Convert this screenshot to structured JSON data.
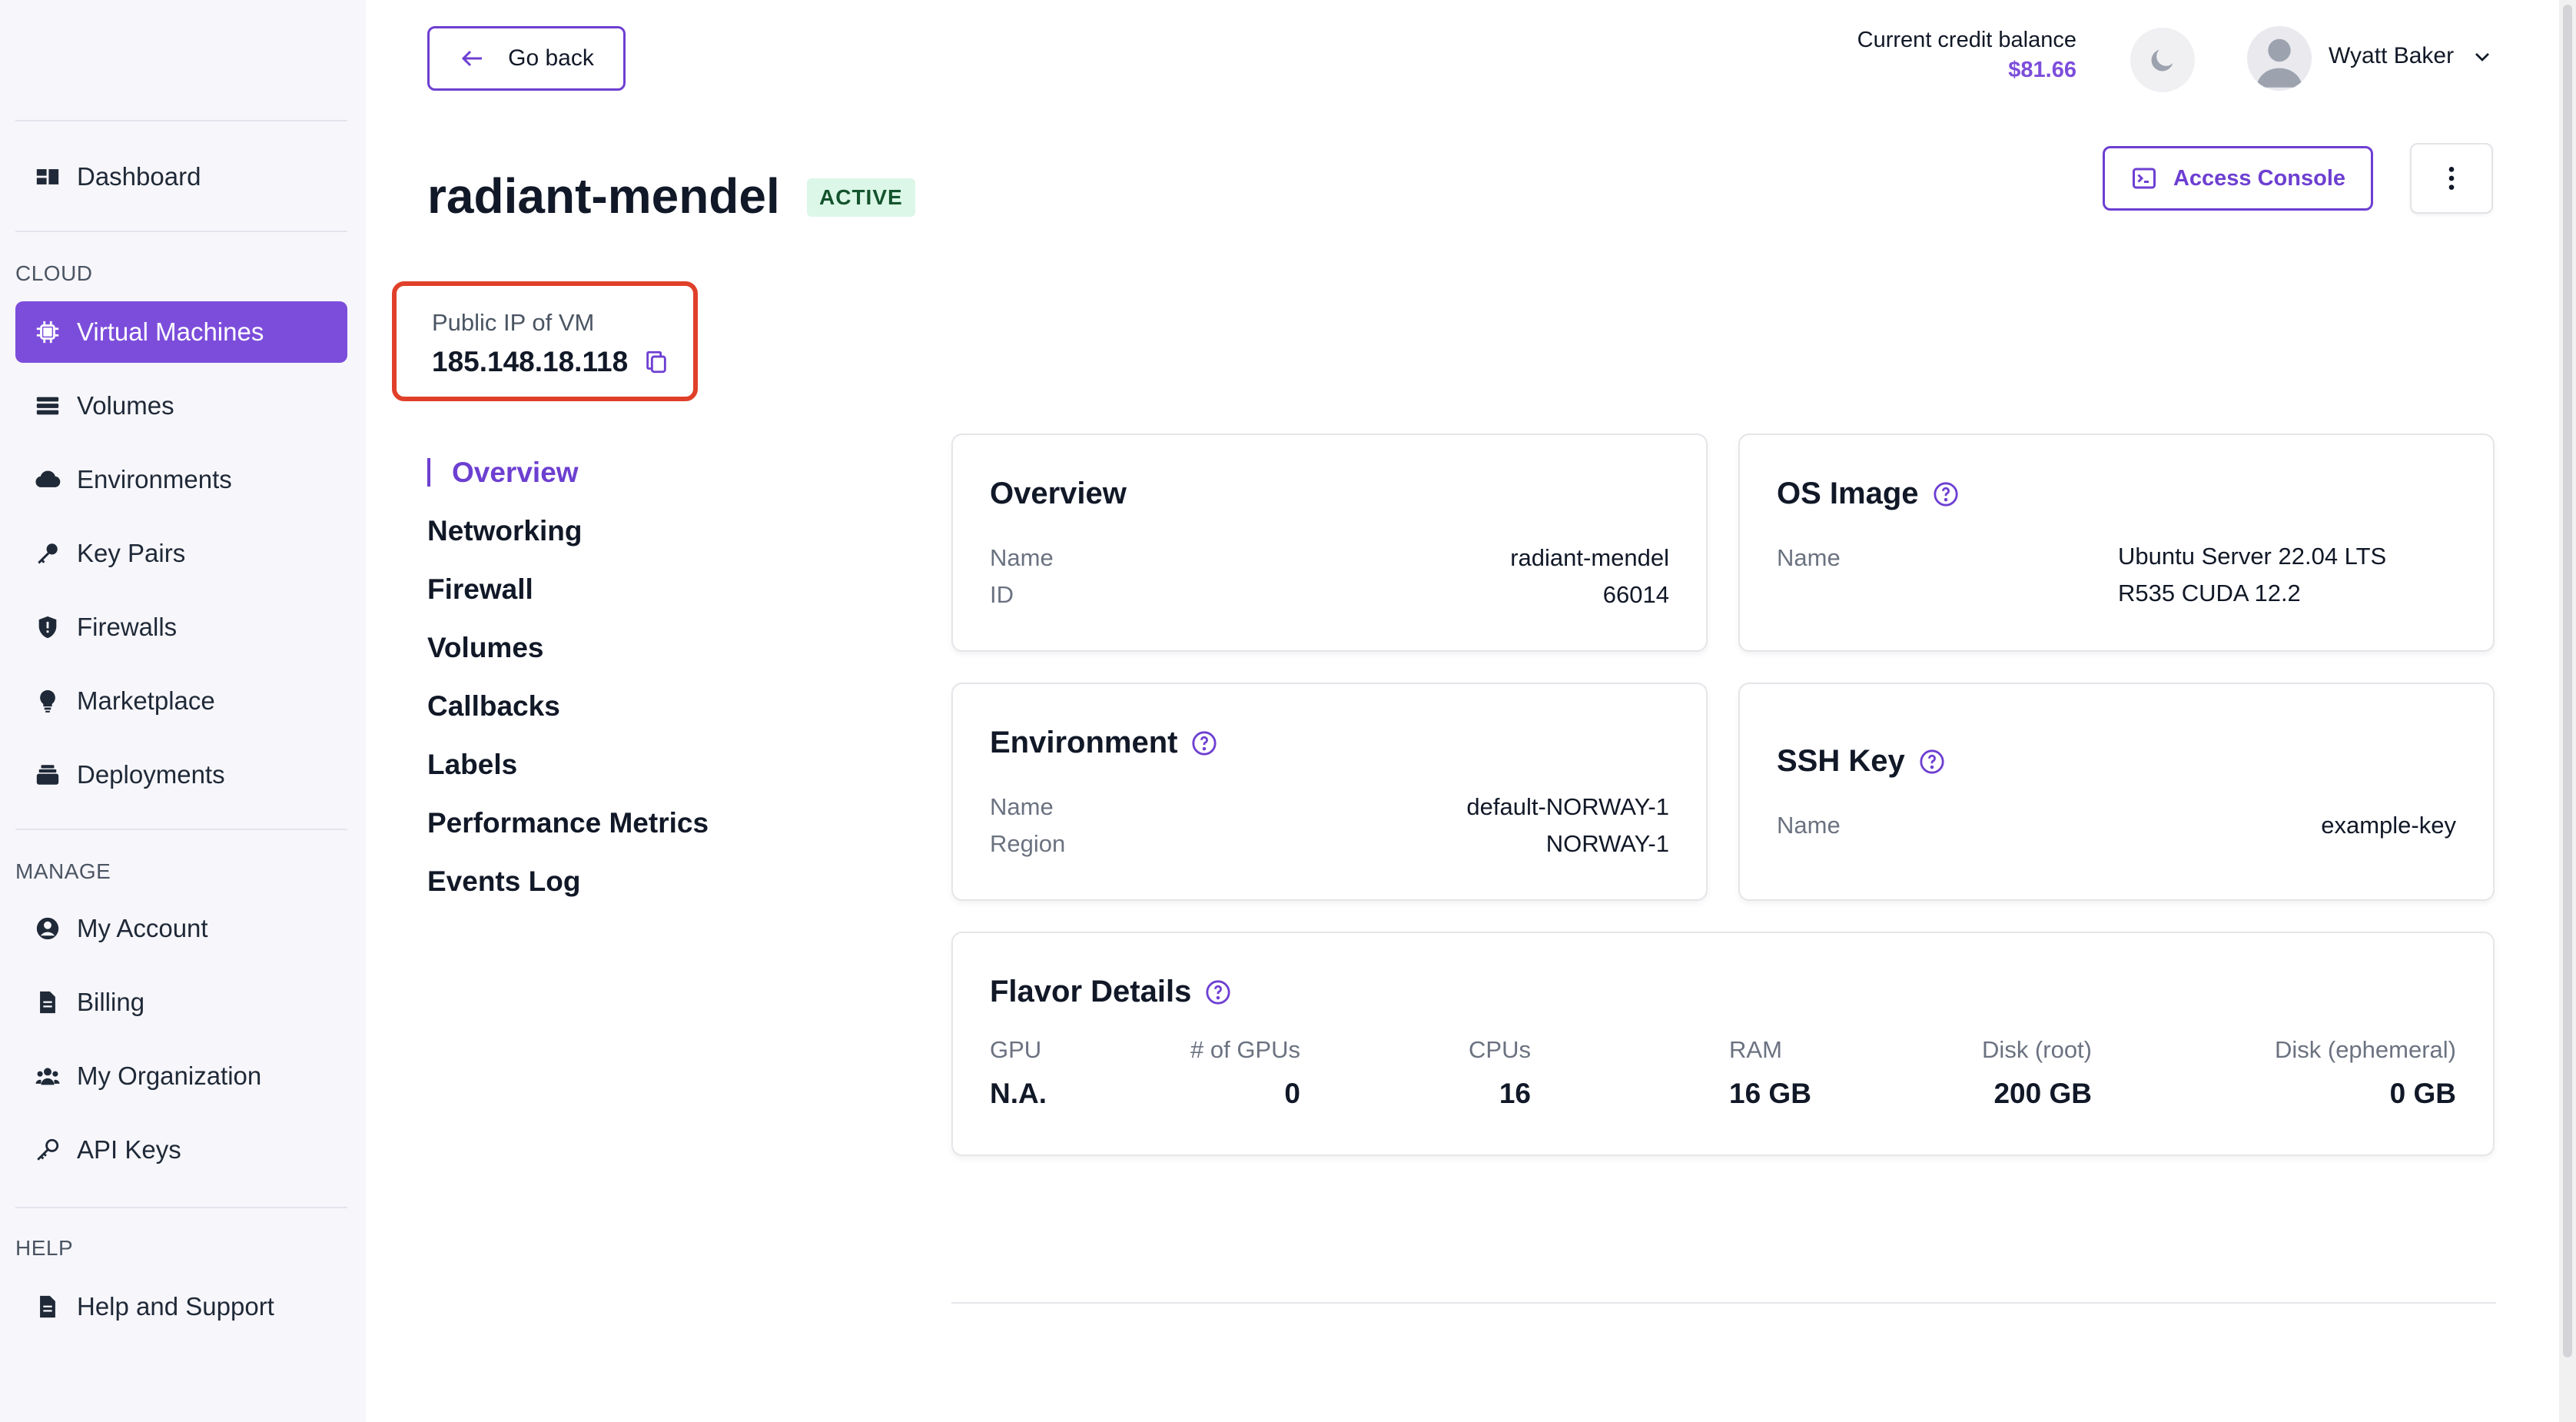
{
  "sidebar": {
    "dashboard": "Dashboard",
    "sections": {
      "cloud": "CLOUD",
      "manage": "MANAGE",
      "help": "HELP"
    },
    "cloud_items": [
      {
        "label": "Virtual Machines",
        "icon": "chip-icon",
        "active": true
      },
      {
        "label": "Volumes",
        "icon": "database-icon"
      },
      {
        "label": "Environments",
        "icon": "cloud-icon"
      },
      {
        "label": "Key Pairs",
        "icon": "key-icon"
      },
      {
        "label": "Firewalls",
        "icon": "shield-icon"
      },
      {
        "label": "Marketplace",
        "icon": "lightbulb-icon"
      },
      {
        "label": "Deployments",
        "icon": "stack-icon"
      }
    ],
    "manage_items": [
      {
        "label": "My Account",
        "icon": "user-circle-icon"
      },
      {
        "label": "Billing",
        "icon": "document-icon"
      },
      {
        "label": "My Organization",
        "icon": "users-icon"
      },
      {
        "label": "API Keys",
        "icon": "key-outline-icon"
      }
    ],
    "help_items": [
      {
        "label": "Help and Support",
        "icon": "document-icon"
      }
    ]
  },
  "header": {
    "go_back": "Go back",
    "credit_label": "Current credit balance",
    "credit_value": "$81.66",
    "user_name": "Wyatt Baker"
  },
  "vm": {
    "name": "radiant-mendel",
    "status": "ACTIVE",
    "access_console": "Access Console",
    "ip_label": "Public IP of VM",
    "ip_value": "185.148.18.118"
  },
  "nav": [
    "Overview",
    "Networking",
    "Firewall",
    "Volumes",
    "Callbacks",
    "Labels",
    "Performance Metrics",
    "Events Log"
  ],
  "cards": {
    "overview": {
      "title": "Overview",
      "name_key": "Name",
      "name_val": "radiant-mendel",
      "id_key": "ID",
      "id_val": "66014"
    },
    "os_image": {
      "title": "OS Image",
      "name_key": "Name",
      "name_val_line1": "Ubuntu Server 22.04 LTS",
      "name_val_line2": "R535 CUDA 12.2"
    },
    "environment": {
      "title": "Environment",
      "name_key": "Name",
      "name_val": "default-NORWAY-1",
      "region_key": "Region",
      "region_val": "NORWAY-1"
    },
    "ssh_key": {
      "title": "SSH Key",
      "name_key": "Name",
      "name_val": "example-key"
    },
    "flavor": {
      "title": "Flavor Details",
      "columns": [
        {
          "key": "GPU",
          "value": "N.A."
        },
        {
          "key": "# of GPUs",
          "value": "0"
        },
        {
          "key": "CPUs",
          "value": "16"
        },
        {
          "key": "RAM",
          "value": "16 GB"
        },
        {
          "key": "Disk (root)",
          "value": "200 GB"
        },
        {
          "key": "Disk (ephemeral)",
          "value": "0 GB"
        }
      ]
    }
  },
  "colors": {
    "accent": "#6d3fd1",
    "active_bg": "#7c4ddb",
    "highlight": "#e0402a",
    "badge_bg": "#dcf7e8"
  }
}
